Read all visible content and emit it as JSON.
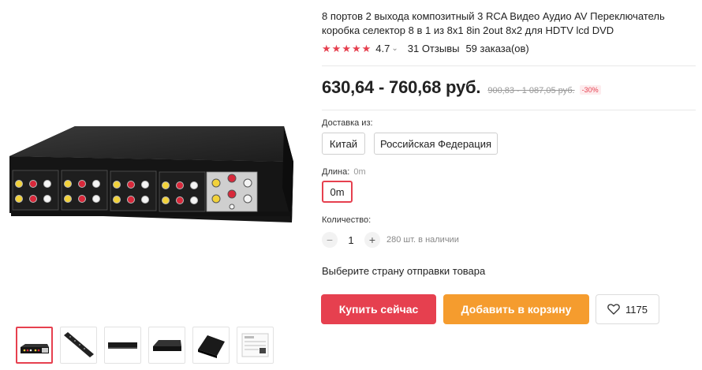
{
  "product": {
    "title": "8 портов 2 выхода композитный 3 RCA Видео Аудио AV Переключатель коробка селектор 8 в 1 из 8x1 8in 2out 8x2 для HDTV lcd DVD",
    "rating": {
      "stars": 5,
      "value": "4.7",
      "chevron": "⌄",
      "reviews": "31 Отзывы",
      "orders": "59 заказа(ов)"
    },
    "price": {
      "current": "630,64 - 760,68 руб.",
      "old": "900,83 - 1 087,05 руб.",
      "discount": "-30%"
    }
  },
  "delivery": {
    "label": "Доставка из:",
    "options": [
      "Китай",
      "Российская Федерация"
    ]
  },
  "length": {
    "label": "Длина:",
    "selected": "0m",
    "options": [
      "0m"
    ]
  },
  "quantity": {
    "label": "Количество:",
    "minus": "−",
    "value": "1",
    "plus": "+",
    "stock": "280 шт. в наличии"
  },
  "shipping_note": "Выберите страну отправки товара",
  "actions": {
    "buy_now": "Купить сейчас",
    "add_to_cart": "Добавить в корзину",
    "wishlist_count": "1175"
  },
  "icons": {
    "star": "star-icon",
    "heart": "heart-icon",
    "minus": "minus-icon",
    "plus": "plus-icon"
  },
  "colors": {
    "accent_red": "#e6404f",
    "cart_orange": "#f59c2e"
  },
  "gallery": {
    "thumbnail_count": 6,
    "active_index": 0
  }
}
